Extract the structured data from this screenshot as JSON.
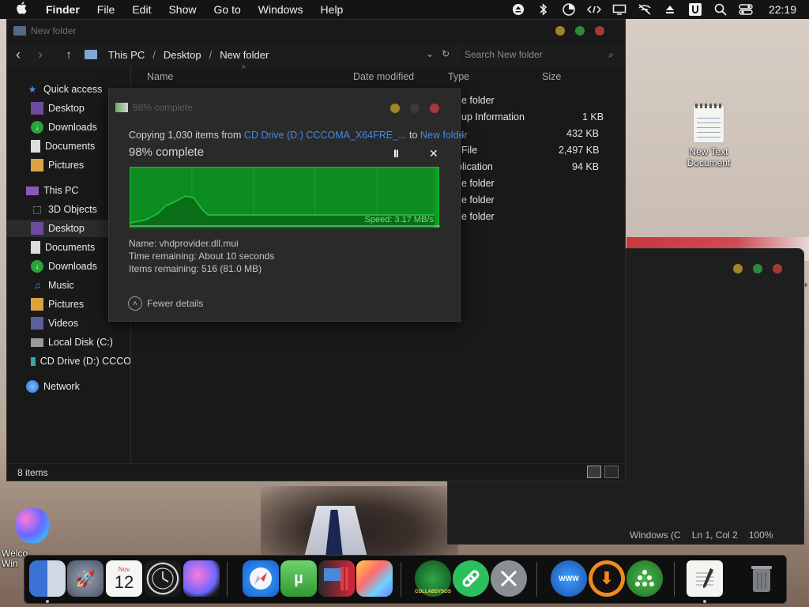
{
  "menubar": {
    "app_name": "Finder",
    "menus": [
      "File",
      "Edit",
      "Show",
      "Go to",
      "Windows",
      "Help"
    ],
    "clock": "22:19",
    "status_icons": [
      "eject-icon",
      "bluetooth-icon",
      "pie-chart-icon",
      "code-icon",
      "display-icon",
      "wifi-off-icon",
      "upload-icon",
      "u-icon",
      "search-icon",
      "control-center-icon"
    ]
  },
  "explorer": {
    "title": "New folder",
    "breadcrumb": [
      "This PC",
      "Desktop",
      "New folder"
    ],
    "search_placeholder": "Search New folder",
    "columns": [
      "Name",
      "Date modified",
      "Type",
      "Size"
    ],
    "sidebar": {
      "quick_access": "Quick access",
      "quick_items": [
        "Desktop",
        "Downloads",
        "Documents",
        "Pictures"
      ],
      "this_pc": "This PC",
      "pc_items": [
        "3D Objects",
        "Desktop",
        "Documents",
        "Downloads",
        "Music",
        "Pictures",
        "Videos",
        "Local Disk (C:)",
        "CD Drive (D:) CCCO"
      ],
      "network": "Network"
    },
    "files": [
      {
        "type": "e folder",
        "size": ""
      },
      {
        "type": "up Information",
        "size": "1 KB"
      },
      {
        "type": ":",
        "size": "432 KB"
      },
      {
        "type": "File",
        "size": "2,497 KB"
      },
      {
        "type": "plication",
        "size": "94 KB"
      },
      {
        "type": "e folder",
        "size": ""
      },
      {
        "type": "e folder",
        "size": ""
      },
      {
        "type": "e folder",
        "size": ""
      }
    ],
    "status": "8 items"
  },
  "copy_dialog": {
    "title": "98% complete",
    "copying_prefix": "Copying 1,030 items from",
    "source": "CD Drive (D:) CCCOMA_X64FRE_...",
    "to_word": "to",
    "destination": "New folder",
    "percent_text": "98% complete",
    "pause_glyph": "II",
    "close_glyph": "✕",
    "speed": "Speed: 3.17 MB/s",
    "progress": 0.98,
    "name_line": "Name:  vhdprovider.dll.mui",
    "time_line": "Time remaining:  About 10 seconds",
    "items_line": "Items remaining:  516 (81.0 MB)",
    "fewer_details": "Fewer details"
  },
  "editor": {
    "encoding": "Windows (C",
    "position": "Ln 1, Col 2",
    "zoom": "100%"
  },
  "desktop": {
    "new_text_doc": "New Text Document",
    "welcome_partial_1": "Welco",
    "welcome_partial_2": "Win"
  },
  "dock": {
    "calendar_month": "Nov",
    "calendar_day": "12",
    "collabsysos_label": "COLLABSYSOS",
    "ie_label": "WWW"
  },
  "colors": {
    "accent_link": "#3c8cf0",
    "graph_green": "#109b25",
    "traffic_yellow": "#a0832b",
    "traffic_green": "#2f8a37",
    "traffic_red": "#a43a3a"
  }
}
